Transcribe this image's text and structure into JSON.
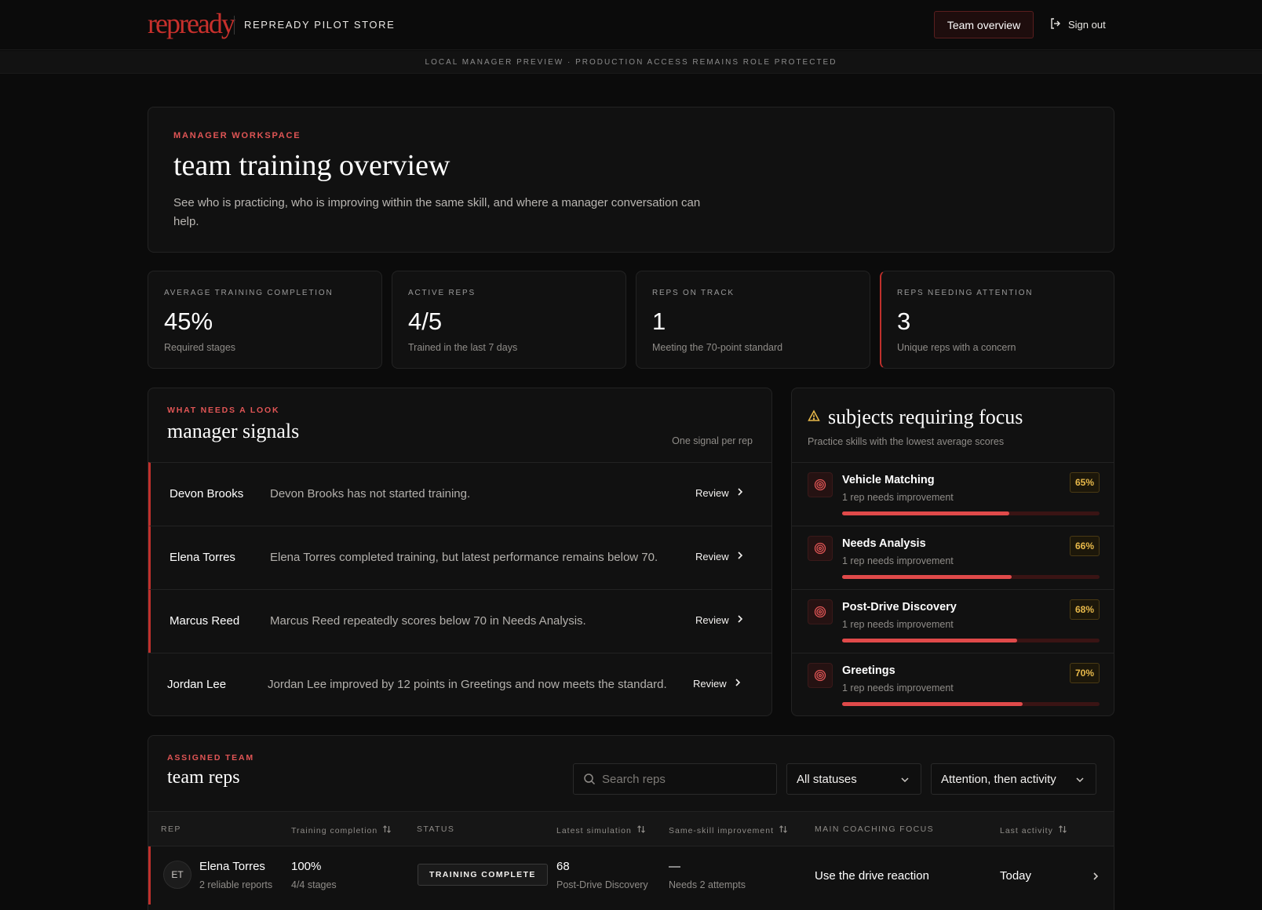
{
  "header": {
    "logo_text": "repready",
    "store_name": "REPREADY PILOT STORE",
    "team_overview_label": "Team overview",
    "sign_out_label": "Sign out",
    "preview_notice": "LOCAL MANAGER PREVIEW · PRODUCTION ACCESS REMAINS ROLE PROTECTED"
  },
  "hero": {
    "eyebrow": "MANAGER WORKSPACE",
    "title": "team training overview",
    "description": "See who is practicing, who is improving within the same skill, and where a manager conversation can help."
  },
  "stats": [
    {
      "label": "AVERAGE TRAINING COMPLETION",
      "value": "45%",
      "sub": "Required stages"
    },
    {
      "label": "ACTIVE REPS",
      "value": "4/5",
      "sub": "Trained in the last 7 days"
    },
    {
      "label": "REPS ON TRACK",
      "value": "1",
      "sub": "Meeting the 70-point standard"
    },
    {
      "label": "REPS NEEDING ATTENTION",
      "value": "3",
      "sub": "Unique reps with a concern"
    }
  ],
  "signals": {
    "eyebrow": "WHAT NEEDS A LOOK",
    "title": "manager signals",
    "note": "One signal per rep",
    "review_label": "Review",
    "items": [
      {
        "name": "Devon Brooks",
        "text": "Devon Brooks has not started training.",
        "flagged": true
      },
      {
        "name": "Elena Torres",
        "text": "Elena Torres completed training, but latest performance remains below 70.",
        "flagged": true
      },
      {
        "name": "Marcus Reed",
        "text": "Marcus Reed repeatedly scores below 70 in Needs Analysis.",
        "flagged": true
      },
      {
        "name": "Jordan Lee",
        "text": "Jordan Lee improved by 12 points in Greetings and now meets the standard.",
        "flagged": false
      }
    ]
  },
  "focus": {
    "title": "subjects requiring focus",
    "subtitle": "Practice skills with the lowest average scores",
    "skills": [
      {
        "name": "Vehicle Matching",
        "sub": "1 rep needs improvement",
        "pct_label": "65%",
        "score": 0.65
      },
      {
        "name": "Needs Analysis",
        "sub": "1 rep needs improvement",
        "pct_label": "66%",
        "score": 0.66
      },
      {
        "name": "Post-Drive Discovery",
        "sub": "1 rep needs improvement",
        "pct_label": "68%",
        "score": 0.68
      },
      {
        "name": "Greetings",
        "sub": "1 rep needs improvement",
        "pct_label": "70%",
        "score": 0.7
      }
    ]
  },
  "reps": {
    "eyebrow": "ASSIGNED TEAM",
    "title": "team reps",
    "search_placeholder": "Search reps",
    "status_filter": "All statuses",
    "sort_filter": "Attention, then activity",
    "columns": {
      "rep": "REP",
      "training": "Training completion",
      "status": "STATUS",
      "latest": "Latest simulation",
      "improvement": "Same-skill improvement",
      "coaching": "MAIN COACHING FOCUS",
      "activity": "Last activity"
    },
    "rows": [
      {
        "initials": "ET",
        "name": "Elena Torres",
        "reports": "2 reliable reports",
        "completion": "100%",
        "stages": "4/4 stages",
        "status": "TRAINING COMPLETE",
        "latest_score": "68",
        "latest_skill": "Post-Drive Discovery",
        "improvement": "—",
        "improvement_note": "Needs 2 attempts",
        "coaching": "Use the drive reaction",
        "activity": "Today"
      }
    ]
  },
  "colors": {
    "accent_red": "#e05555",
    "flag_red": "#c0302c",
    "score_amber": "#e8b94a",
    "background": "#0b0b0b",
    "panel": "#111111"
  }
}
